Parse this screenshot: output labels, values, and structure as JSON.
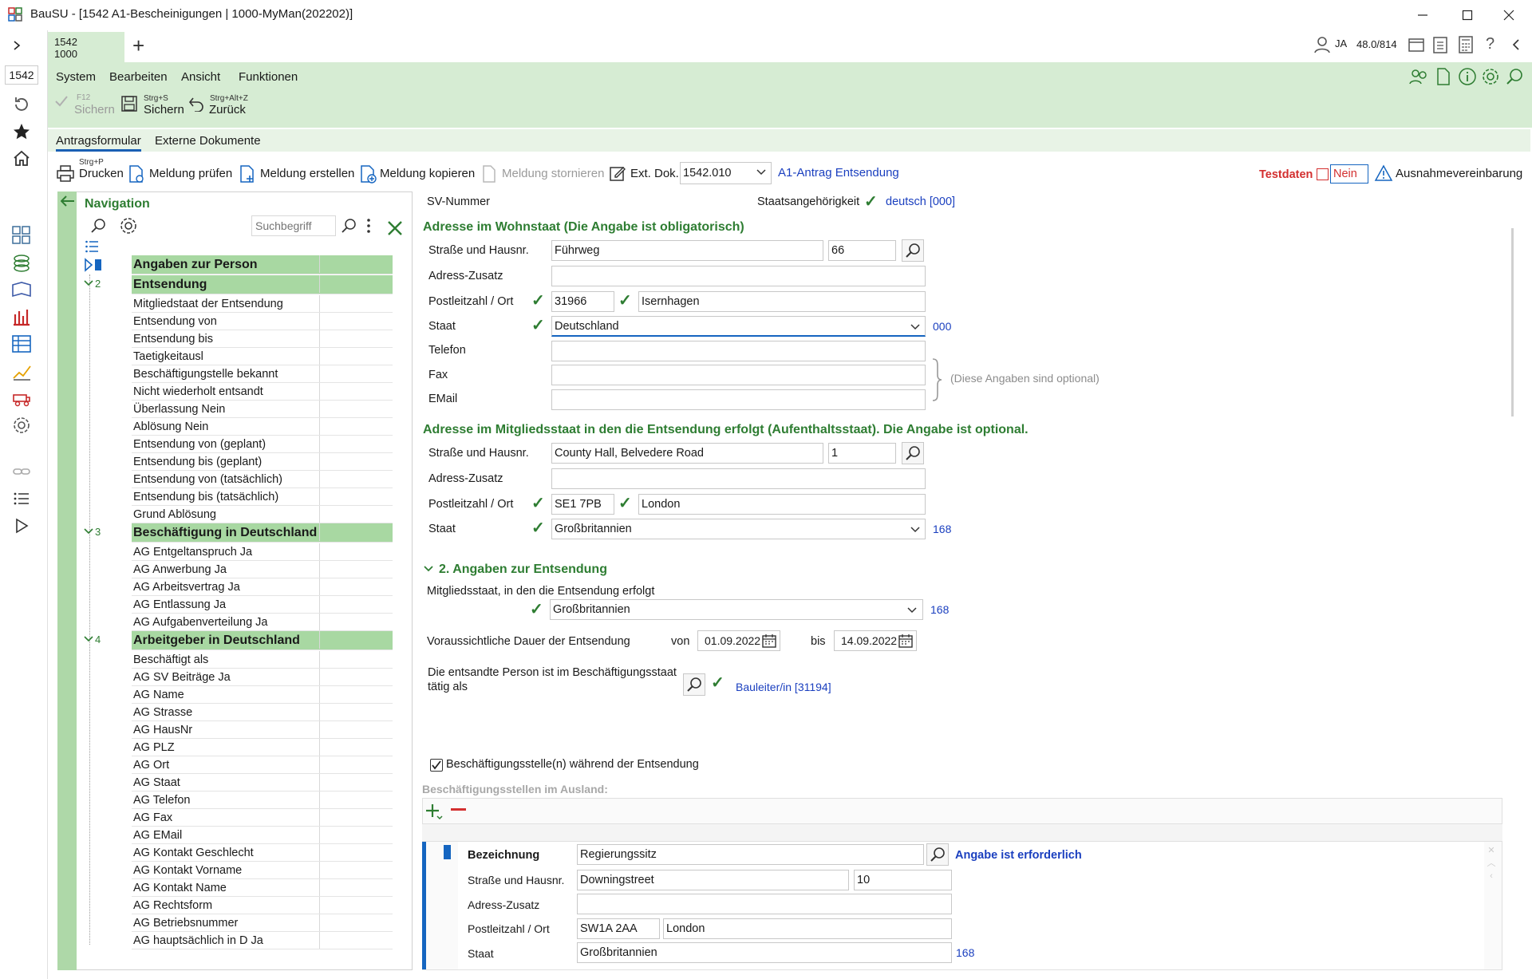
{
  "window": {
    "title": "BauSU - [1542 A1-Bescheinigungen | 1000-MyMan(202202)]"
  },
  "tab": {
    "line1": "1542",
    "line2": "1000",
    "add": "+"
  },
  "leftbar": {
    "selector": "1542"
  },
  "topright": {
    "user": "JA",
    "version": "48.0/814",
    "help": "?"
  },
  "menu": {
    "system": "System",
    "bearbeiten": "Bearbeiten",
    "ansicht": "Ansicht",
    "funktionen": "Funktionen"
  },
  "toolbar": {
    "sichern1_small": "F12",
    "sichern1_label": "Sichern",
    "sichern2_small": "Strg+S",
    "sichern2_label": "Sichern",
    "zurueck_small": "Strg+Alt+Z",
    "zurueck_label": "Zurück"
  },
  "content_tabs": {
    "tab1": "Antragsformular",
    "tab2": "Externe Dokumente"
  },
  "main_toolbar": {
    "drucken_small": "Strg+P",
    "drucken": "Drucken",
    "pruefen": "Meldung prüfen",
    "erstellen": "Meldung erstellen",
    "kopieren": "Meldung kopieren",
    "stornieren": "Meldung stornieren",
    "extdok": "Ext. Dok.",
    "extdok_value": "1542.010",
    "a1_link": "A1-Antrag Entsendung",
    "testdaten": "Testdaten",
    "nein": "Nein",
    "ausnahme": "Ausnahmevereinbarung"
  },
  "navigation": {
    "title": "Navigation",
    "search_placeholder": "Suchbegriff",
    "sections": [
      {
        "num": "",
        "title": "Angaben zur Person",
        "items": []
      },
      {
        "num": "2",
        "title": "Entsendung",
        "items": [
          "Mitgliedstaat der Entsendung",
          "Entsendung von",
          "Entsendung bis",
          "Taetigkeitausl",
          "Beschäftigungstelle bekannt",
          "Nicht wiederholt entsandt",
          "Überlassung Nein",
          "Ablösung Nein",
          "Entsendung von (geplant)",
          "Entsendung bis (geplant)",
          "Entsendung von (tatsächlich)",
          "Entsendung bis (tatsächlich)",
          "Grund Ablösung"
        ]
      },
      {
        "num": "3",
        "title": "Beschäftigung in Deutschland",
        "items": [
          "AG Entgeltanspruch Ja",
          "AG Anwerbung Ja",
          "AG Arbeitsvertrag Ja",
          "AG Entlassung Ja",
          "AG Aufgabenverteilung Ja"
        ]
      },
      {
        "num": "4",
        "title": "Arbeitgeber in Deutschland",
        "items": [
          "Beschäftigt als",
          "AG SV Beiträge Ja",
          "AG Name",
          "AG Strasse",
          "AG HausNr",
          "AG PLZ",
          "AG Ort",
          "AG Staat",
          "AG Telefon",
          "AG Fax",
          "AG EMail",
          "AG Kontakt Geschlecht",
          "AG Kontakt Vorname",
          "AG Kontakt Name",
          "AG Rechtsform",
          "AG Betriebsnummer",
          "AG hauptsächlich in D Ja"
        ]
      }
    ]
  },
  "form": {
    "sv_nummer": "SV-Nummer",
    "staatsangehoerigkeit": "Staatsangehörigkeit",
    "staatsang_value": "deutsch [000]",
    "wohnstaat": {
      "title": "Adresse im Wohnstaat (Die Angabe ist obligatorisch)",
      "strasse_label": "Straße und Hausnr.",
      "strasse": "Führweg",
      "hausnr": "66",
      "zusatz_label": "Adress-Zusatz",
      "zusatz": "",
      "plz_label": "Postleitzahl / Ort",
      "plz": "31966",
      "ort": "Isernhagen",
      "staat_label": "Staat",
      "staat": "Deutschland",
      "staat_code": "000",
      "telefon_label": "Telefon",
      "fax_label": "Fax",
      "email_label": "EMail",
      "optional_note": "(Diese Angaben sind optional)"
    },
    "mitgliedsstaat": {
      "title": "Adresse im Mitgliedsstaat in den die Entsendung erfolgt (Aufenthaltsstaat). Die Angabe ist optional.",
      "strasse_label": "Straße und Hausnr.",
      "strasse": "County Hall, Belvedere Road",
      "hausnr": "1",
      "zusatz_label": "Adress-Zusatz",
      "plz_label": "Postleitzahl / Ort",
      "plz": "SE1 7PB",
      "ort": "London",
      "staat_label": "Staat",
      "staat": "Großbritannien",
      "staat_code": "168"
    },
    "entsendung": {
      "title": "2. Angaben zur Entsendung",
      "mitgliedstaat_label": "Mitgliedsstaat, in den die Entsendung erfolgt",
      "mitgliedstaat": "Großbritannien",
      "mitgliedstaat_code": "168",
      "dauer_label": "Voraussichtliche Dauer der Entsendung",
      "von_label": "von",
      "von": "01.09.2022",
      "bis_label": "bis",
      "bis": "14.09.2022",
      "taetig_label1": "Die entsandte Person ist im Beschäftigungsstaat",
      "taetig_label2": "tätig als",
      "taetig_value": "Bauleiter/in [31194]",
      "checkbox_label": "Beschäftigungsstelle(n) während der Entsendung",
      "ausland_label": "Beschäftigungsstellen im Ausland:"
    },
    "stelle": {
      "bez_label": "Bezeichnung",
      "bez": "Regierungssitz",
      "bez_hint": "Angabe ist erforderlich",
      "strasse_label": "Straße und Hausnr.",
      "strasse": "Downingstreet",
      "hausnr": "10",
      "zusatz_label": "Adress-Zusatz",
      "plz_label": "Postleitzahl / Ort",
      "plz": "SW1A 2AA",
      "ort": "London",
      "staat_label": "Staat",
      "staat": "Großbritannien",
      "staat_code": "168"
    }
  },
  "colors": {
    "accent_green": "#2e7d32",
    "header_bg": "#d6ecd3",
    "nav_head": "#a8d8a2",
    "link": "#1a3fbf",
    "alert": "#d32f2f"
  }
}
